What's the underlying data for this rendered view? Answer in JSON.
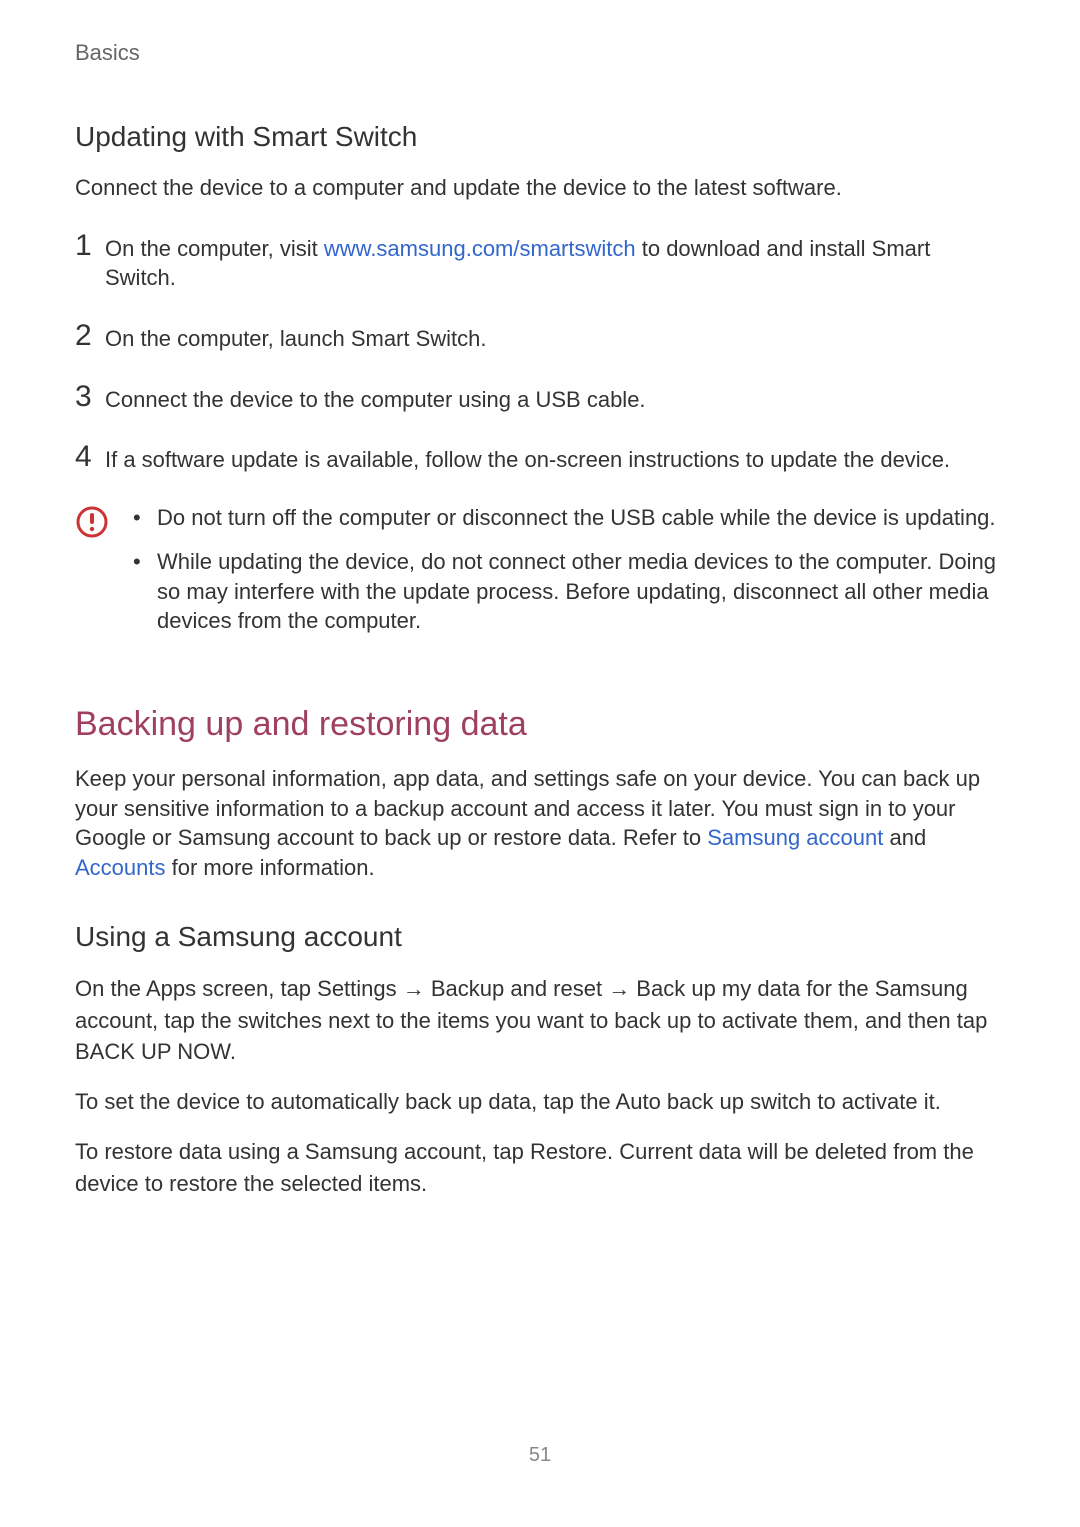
{
  "header": {
    "section": "Basics"
  },
  "section1": {
    "heading": "Updating with Smart Switch",
    "intro": "Connect the device to a computer and update the device to the latest software.",
    "steps": {
      "n1": "1",
      "s1a": "On the computer, visit ",
      "s1link": "www.samsung.com/smartswitch",
      "s1b": " to download and install Smart Switch.",
      "n2": "2",
      "s2": "On the computer, launch Smart Switch.",
      "n3": "3",
      "s3": "Connect the device to the computer using a USB cable.",
      "n4": "4",
      "s4": "If a software update is available, follow the on-screen instructions to update the device."
    },
    "warning": {
      "b1": "Do not turn off the computer or disconnect the USB cable while the device is updating.",
      "b2": "While updating the device, do not connect other media devices to the computer. Doing so may interfere with the update process. Before updating, disconnect all other media devices from the computer."
    }
  },
  "section2": {
    "heading": "Backing up and restoring data",
    "intro_a": "Keep your personal information, app data, and settings safe on your device. You can back up your sensitive information to a backup account and access it later. You must sign in to your Google or Samsung account to back up or restore data. Refer to ",
    "intro_link1": "Samsung account",
    "intro_b": " and ",
    "intro_link2": "Accounts",
    "intro_c": " for more information.",
    "sub_heading": "Using a Samsung account",
    "p1": "On the Apps screen, tap Settings → Backup and reset → Back up my data for the Samsung account, tap the switches next to the items you want to back up to activate them, and then tap BACK UP NOW.",
    "p2": "To set the device to automatically back up data, tap the Auto back up switch to activate it.",
    "p3": "To restore data using a Samsung account, tap Restore. Current data will be deleted from the device to restore the selected items."
  },
  "page_number": "51"
}
